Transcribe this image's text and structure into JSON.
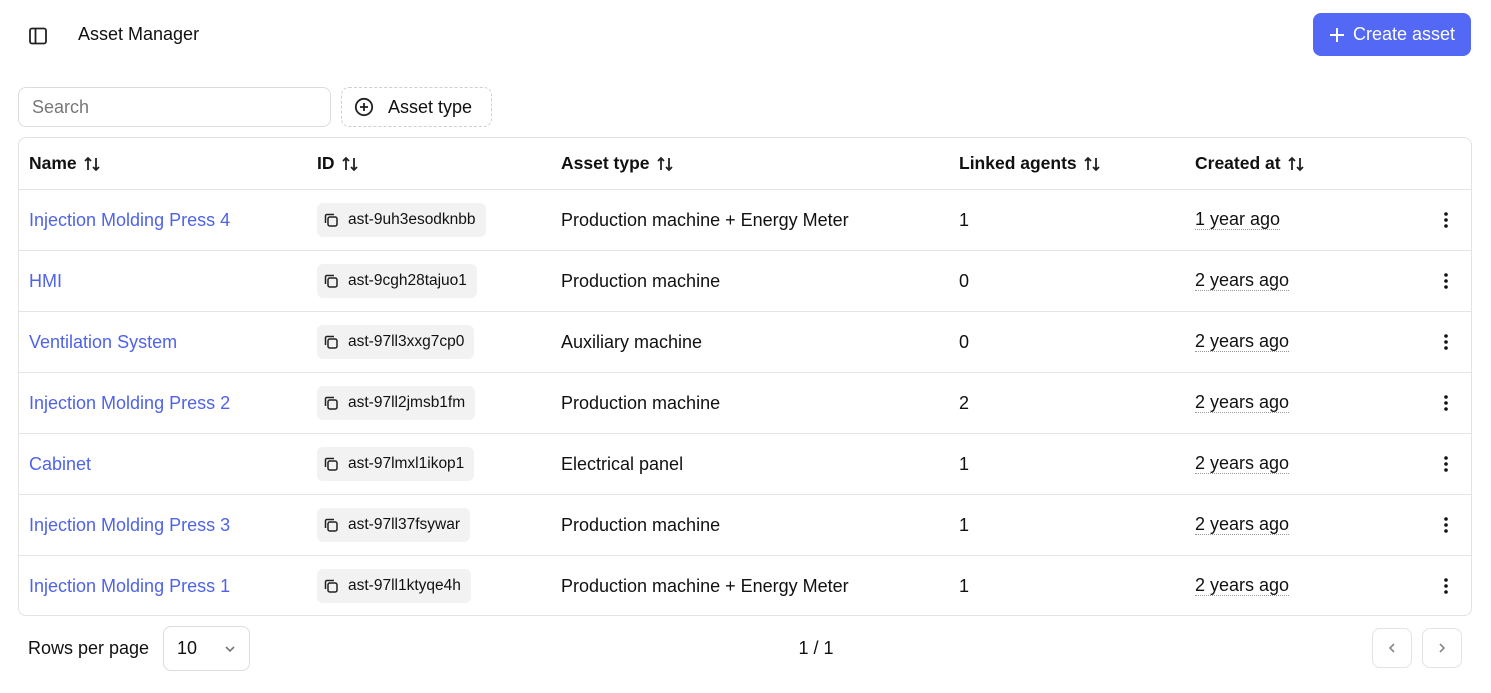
{
  "header": {
    "title": "Asset Manager",
    "create_label": "Create asset",
    "accent": "#5468f6"
  },
  "toolbar": {
    "search_placeholder": "Search",
    "filter_label": "Asset type"
  },
  "table": {
    "columns": [
      "Name",
      "ID",
      "Asset type",
      "Linked agents",
      "Created at"
    ],
    "rows": [
      {
        "name": "Injection Molding Press 4",
        "id": "ast-9uh3esodknbb",
        "type": "Production machine + Energy Meter",
        "linked": "1",
        "created": "1 year ago"
      },
      {
        "name": "HMI",
        "id": "ast-9cgh28tajuo1",
        "type": "Production machine",
        "linked": "0",
        "created": "2 years ago"
      },
      {
        "name": "Ventilation System",
        "id": "ast-97ll3xxg7cp0",
        "type": "Auxiliary machine",
        "linked": "0",
        "created": "2 years ago"
      },
      {
        "name": "Injection Molding Press 2",
        "id": "ast-97ll2jmsb1fm",
        "type": "Production machine",
        "linked": "2",
        "created": "2 years ago"
      },
      {
        "name": "Cabinet",
        "id": "ast-97lmxl1ikop1",
        "type": "Electrical panel",
        "linked": "1",
        "created": "2 years ago"
      },
      {
        "name": "Injection Molding Press 3",
        "id": "ast-97ll37fsywar",
        "type": "Production machine",
        "linked": "1",
        "created": "2 years ago"
      },
      {
        "name": "Injection Molding Press 1",
        "id": "ast-97ll1ktyqe4h",
        "type": "Production machine + Energy Meter",
        "linked": "1",
        "created": "2 years ago"
      }
    ]
  },
  "footer": {
    "rows_per_page_label": "Rows per page",
    "rows_per_page_value": "10",
    "page_info": "1 / 1"
  },
  "icons": {
    "sidebar_toggle": "sidebar-toggle-icon",
    "plus": "plus-icon",
    "add_circle": "plus-circle-icon",
    "sort": "sort-icon",
    "copy": "copy-icon",
    "more": "more-vertical-icon",
    "chevron_down": "chevron-down-icon",
    "chevron_left": "chevron-left-icon",
    "chevron_right": "chevron-right-icon"
  }
}
